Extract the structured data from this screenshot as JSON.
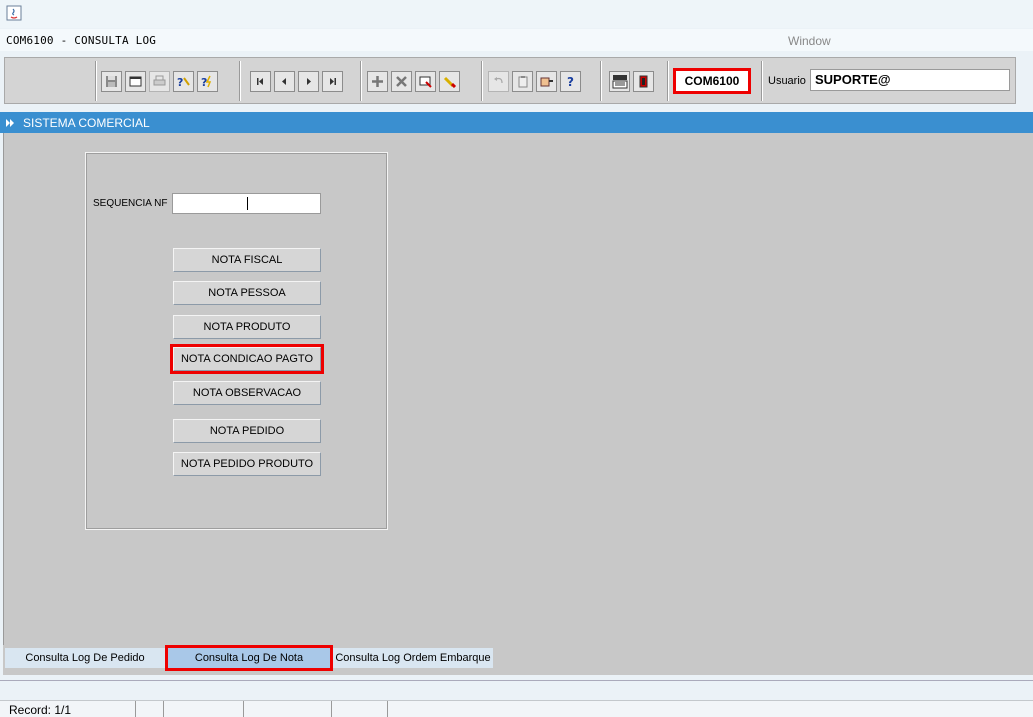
{
  "window": {
    "title": "COM6100 - CONSULTA LOG",
    "menu_window": "Window"
  },
  "toolbar": {
    "module_code": "COM6100",
    "usuario_label": "Usuario",
    "usuario_value": "SUPORTE@",
    "groups": [
      [
        "save-icon",
        "window-icon",
        "print-icon",
        "query-help-icon",
        "execute-query-icon"
      ],
      [
        "first-record-icon",
        "previous-record-icon",
        "next-record-icon",
        "last-record-icon"
      ],
      [
        "insert-record-icon",
        "delete-record-icon",
        "duplicate-icon",
        "clear-icon"
      ],
      [
        "undo-icon",
        "clipboard-icon",
        "hand-icon",
        "help-icon"
      ],
      [
        "menu-icon",
        "exit-icon"
      ]
    ]
  },
  "panel": {
    "title": "SISTEMA COMERCIAL"
  },
  "form": {
    "seq_label": "SEQUENCIA NF",
    "seq_value": "",
    "buttons": [
      "NOTA FISCAL",
      "NOTA PESSOA",
      "NOTA PRODUTO",
      "NOTA CONDICAO PAGTO",
      "NOTA OBSERVACAO",
      "NOTA PEDIDO",
      "NOTA PEDIDO PRODUTO"
    ]
  },
  "tabs": [
    "Consulta Log De Pedido",
    "Consulta Log De Nota",
    "Consulta Log Ordem Embarque"
  ],
  "status": {
    "record": "Record: 1/1"
  },
  "colors": {
    "header_blue": "#3a8fd0",
    "highlight_red": "#ee0000",
    "active_tab": "#a9c8e8"
  }
}
